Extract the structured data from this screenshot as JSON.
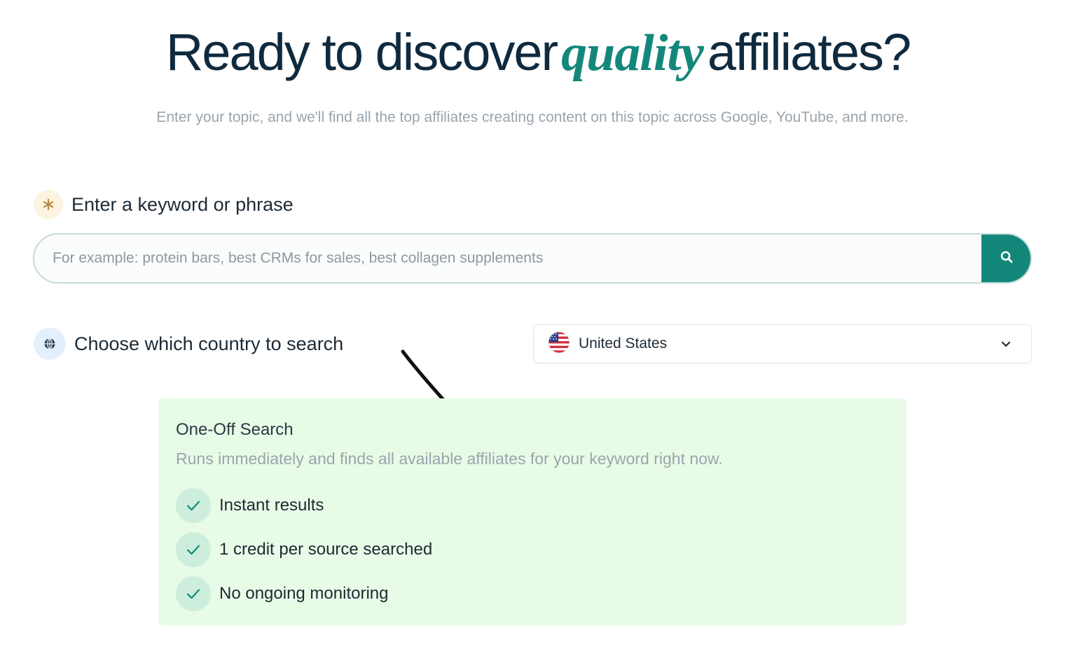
{
  "hero": {
    "title_before": "Ready to discover",
    "title_accent": "quality",
    "title_after": "affiliates?",
    "subtitle": "Enter your topic, and we'll find all the top affiliates creating content on this topic across Google, YouTube, and more."
  },
  "keyword_step": {
    "icon": "asterisk-icon",
    "label": "Enter a keyword or phrase",
    "input_value": "",
    "input_placeholder": "For example: protein bars, best CRMs for sales, best collagen supplements",
    "search_button_icon": "search-icon"
  },
  "country_step": {
    "icon": "globe-icon",
    "label": "Choose which country to search",
    "selected_country": "United States",
    "flag_icon": "us-flag-icon",
    "dropdown_icon": "chevron-down-icon"
  },
  "one_off_card": {
    "title": "One-Off Search",
    "description": "Runs immediately and finds all available affiliates for your keyword right now.",
    "features": [
      {
        "label": "Instant results",
        "icon": "check-icon"
      },
      {
        "label": "1 credit per source searched",
        "icon": "check-icon"
      },
      {
        "label": "No ongoing monitoring",
        "icon": "check-icon"
      }
    ]
  },
  "colors": {
    "brand_teal": "#14877b",
    "heading_navy": "#0f2a3e",
    "card_green": "#e8fbe6",
    "check_bg": "#cdeedd"
  }
}
